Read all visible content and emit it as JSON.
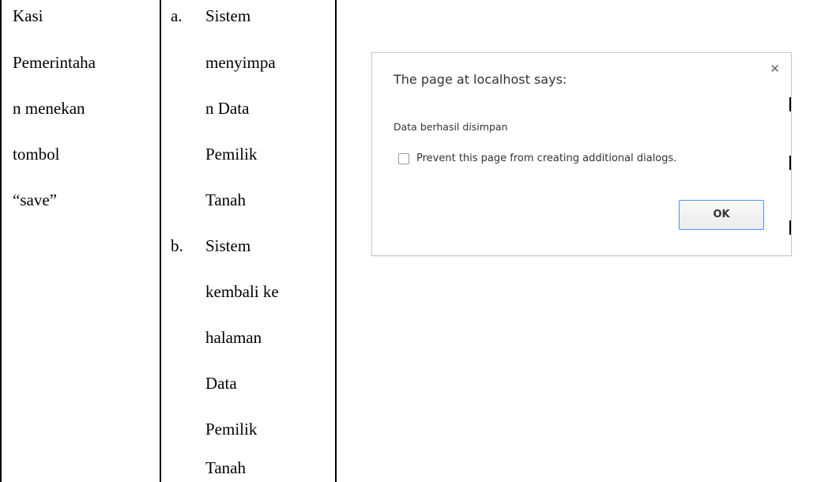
{
  "table": {
    "col1_lines": [
      "Kasi",
      "Pemerintaha",
      "n menekan",
      "tombol",
      "“save”"
    ],
    "col2_items": [
      {
        "marker": "a.",
        "lines": [
          "Sistem",
          "menyimpa",
          "n Data",
          "Pemilik",
          "Tanah"
        ]
      },
      {
        "marker": "b.",
        "lines": [
          "Sistem",
          "kembali ke",
          "halaman",
          "Data",
          "Pemilik",
          "Tanah"
        ]
      }
    ]
  },
  "dialog": {
    "title": "The page at localhost says:",
    "close_icon": "close-icon",
    "message": "Data berhasil disimpan",
    "checkbox_label": "Prevent this page from creating additional dialogs.",
    "checkbox_checked": false,
    "ok_label": "OK",
    "accent_color": "#4d90fe"
  }
}
